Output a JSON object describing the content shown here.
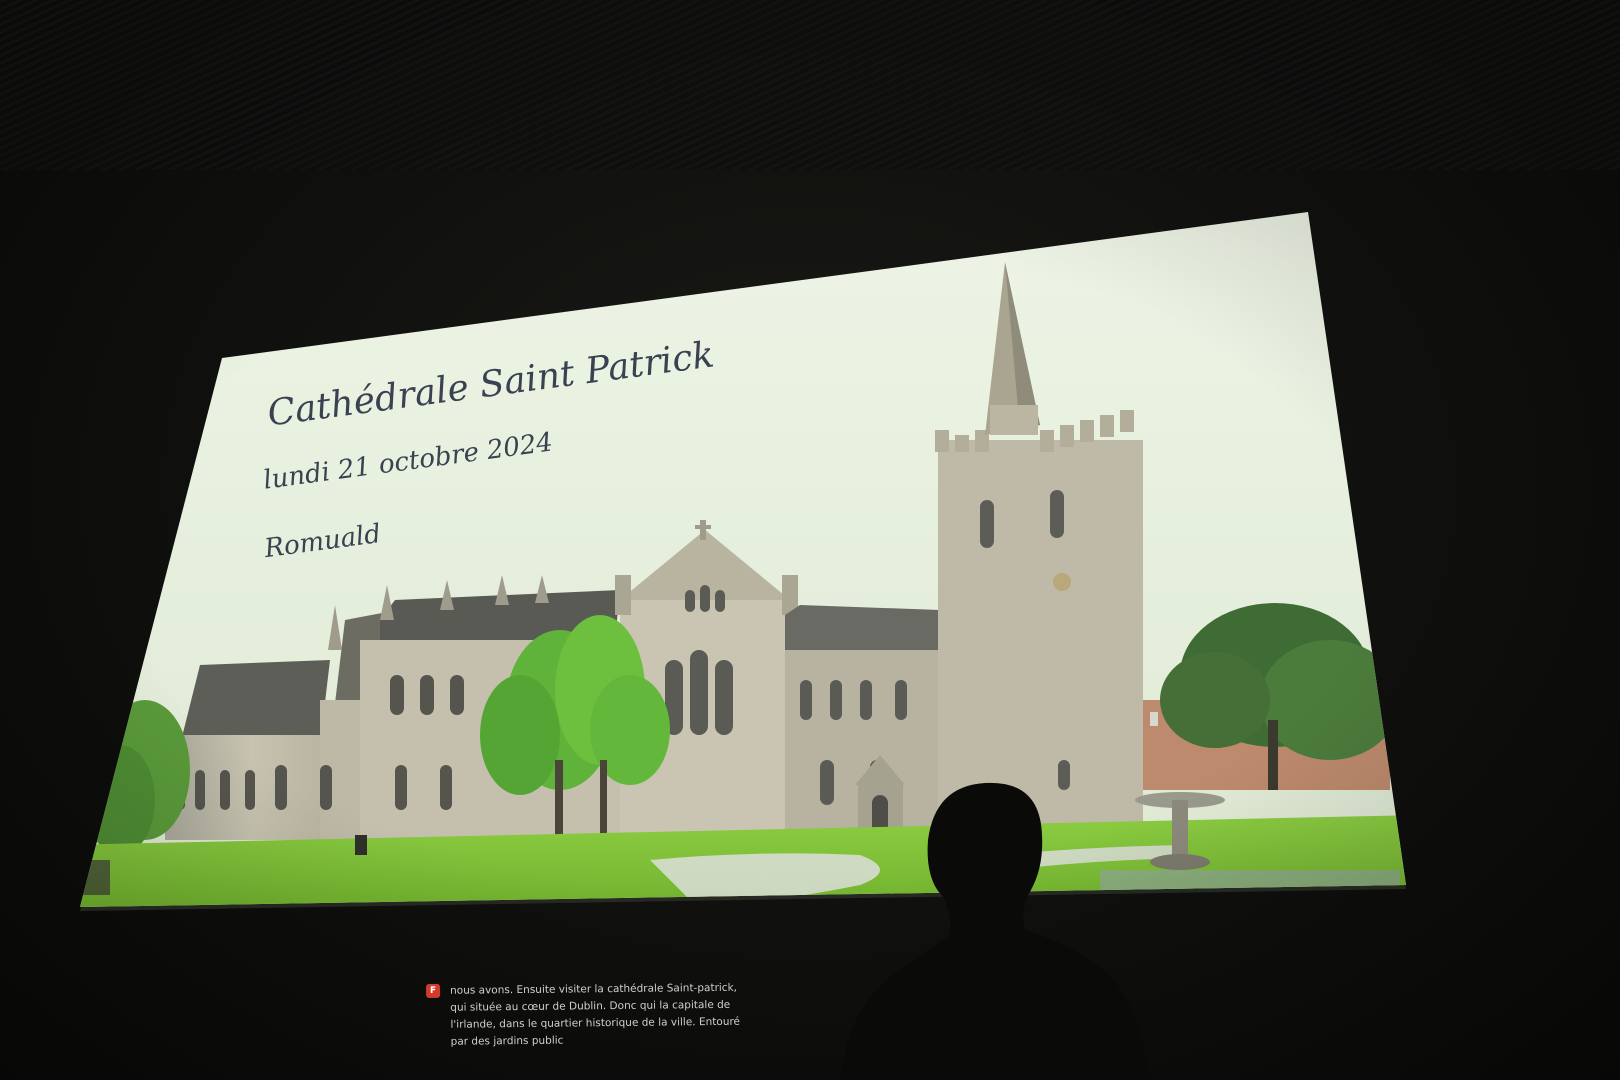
{
  "slide": {
    "title": "Cathédrale Saint Patrick",
    "date": "lundi 21 octobre 2024",
    "author": "Romuald"
  },
  "caption": {
    "badge": "F",
    "lines": [
      "nous avons. Ensuite visiter la cathédrale Saint-patrick,",
      "qui située au cœur de Dublin. Donc qui la capitale de",
      "l'irlande, dans le quartier historique de la ville. Entouré",
      "par des jardins public"
    ]
  },
  "colors": {
    "sky": "#e6f0dc",
    "stone": "#b9b6a4",
    "grass": "#7fc23a",
    "text": "#3a4150",
    "caption_badge": "#d23a2a"
  }
}
